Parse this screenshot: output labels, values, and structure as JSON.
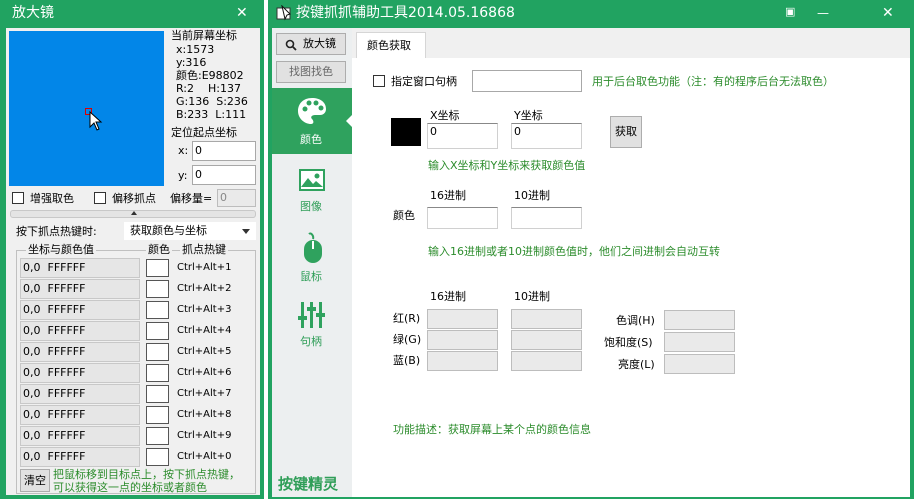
{
  "magnifier": {
    "title": "放大镜",
    "close": "✕",
    "coords_title": "当前屏幕坐标",
    "x_line": "x:1573",
    "y_line": "y:316",
    "color_line": "颜色:E98802",
    "rh_line": "R:2    H:137",
    "gs_line": "G:136  S:236",
    "bl_line": "B:233  L:111",
    "origin_title": "定位起点坐标",
    "origin_x_label": "x:",
    "origin_x": "0",
    "origin_y_label": "y:",
    "origin_y": "0",
    "enhance_label": "增强取色",
    "offset_label": "偏移抓点",
    "offset_amount_label": "偏移量=",
    "offset_amount": "0",
    "hotkey_label": "按下抓点热键时:",
    "hotkey_value": "获取颜色与坐标",
    "col_headers": [
      "坐标与颜色值",
      "颜色",
      "抓点热键"
    ],
    "rows": [
      {
        "value": "0,0  FFFFFF",
        "hotkey": "Ctrl+Alt+1"
      },
      {
        "value": "0,0  FFFFFF",
        "hotkey": "Ctrl+Alt+2"
      },
      {
        "value": "0,0  FFFFFF",
        "hotkey": "Ctrl+Alt+3"
      },
      {
        "value": "0,0  FFFFFF",
        "hotkey": "Ctrl+Alt+4"
      },
      {
        "value": "0,0  FFFFFF",
        "hotkey": "Ctrl+Alt+5"
      },
      {
        "value": "0,0  FFFFFF",
        "hotkey": "Ctrl+Alt+6"
      },
      {
        "value": "0,0  FFFFFF",
        "hotkey": "Ctrl+Alt+7"
      },
      {
        "value": "0,0  FFFFFF",
        "hotkey": "Ctrl+Alt+8"
      },
      {
        "value": "0,0  FFFFFF",
        "hotkey": "Ctrl+Alt+9"
      },
      {
        "value": "0,0  FFFFFF",
        "hotkey": "Ctrl+Alt+0"
      }
    ],
    "clear_label": "清空",
    "hint_line1": "把鼠标移到目标点上，按下抓点热键，",
    "hint_line2": "可以获得这一点的坐标或者颜色"
  },
  "main": {
    "title": "按键抓抓辅助工具2014.05.16868",
    "min": "▣",
    "minimize": "—",
    "close": "✕",
    "top_buttons": [
      "放大镜",
      "找图找色"
    ],
    "nav": [
      {
        "label": "颜色",
        "icon": "palette-icon"
      },
      {
        "label": "图像",
        "icon": "image-icon"
      },
      {
        "label": "鼠标",
        "icon": "mouse-icon"
      },
      {
        "label": "句柄",
        "icon": "sliders-icon"
      }
    ],
    "brand": "按键精灵",
    "tab": "颜色获取",
    "specify_handle_label": "指定窗口句柄",
    "handle_value": "",
    "handle_hint": "用于后台取色功能（注：有的程序后台无法取色）",
    "x_label": "X坐标",
    "x_value": "0",
    "y_label": "Y坐标",
    "y_value": "0",
    "get_button": "获取",
    "xy_hint": "输入X坐标和Y坐标来获取颜色值",
    "hex_label": "16进制",
    "dec_label": "10进制",
    "color_label": "颜色",
    "hex_dec_hint": "输入16进制或者10进制颜色值时，他们之间进制会自动互转",
    "hex_label2": "16进制",
    "dec_label2": "10进制",
    "red_label": "红(R)",
    "green_label": "绿(G)",
    "blue_label": "蓝(B)",
    "hue_label": "色调(H)",
    "sat_label": "饱和度(S)",
    "lum_label": "亮度(L)",
    "description": "功能描述：获取屏幕上某个点的颜色信息",
    "colors": {
      "title_green": "#21a361",
      "sidebar_green": "#2fa25e",
      "preview_blue": "#0286e8",
      "swatch": "#000000"
    }
  }
}
